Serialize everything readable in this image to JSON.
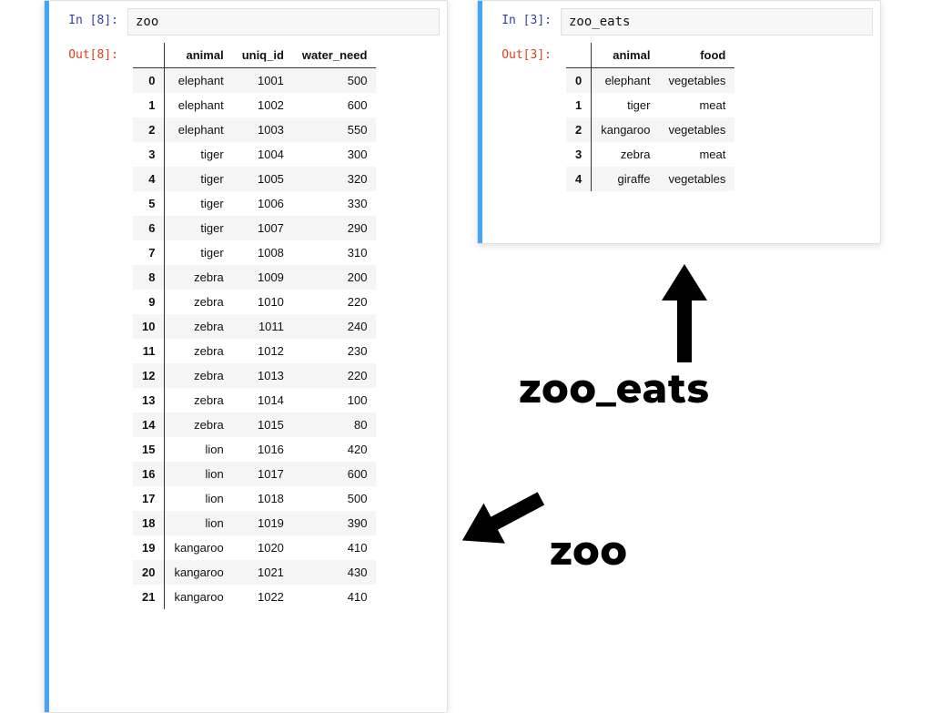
{
  "left_cell": {
    "in_prompt": "In [8]:",
    "out_prompt": "Out[8]:",
    "code": "zoo",
    "columns": [
      "animal",
      "uniq_id",
      "water_need"
    ],
    "rows": [
      {
        "idx": "0",
        "animal": "elephant",
        "uniq_id": "1001",
        "water_need": "500"
      },
      {
        "idx": "1",
        "animal": "elephant",
        "uniq_id": "1002",
        "water_need": "600"
      },
      {
        "idx": "2",
        "animal": "elephant",
        "uniq_id": "1003",
        "water_need": "550"
      },
      {
        "idx": "3",
        "animal": "tiger",
        "uniq_id": "1004",
        "water_need": "300"
      },
      {
        "idx": "4",
        "animal": "tiger",
        "uniq_id": "1005",
        "water_need": "320"
      },
      {
        "idx": "5",
        "animal": "tiger",
        "uniq_id": "1006",
        "water_need": "330"
      },
      {
        "idx": "6",
        "animal": "tiger",
        "uniq_id": "1007",
        "water_need": "290"
      },
      {
        "idx": "7",
        "animal": "tiger",
        "uniq_id": "1008",
        "water_need": "310"
      },
      {
        "idx": "8",
        "animal": "zebra",
        "uniq_id": "1009",
        "water_need": "200"
      },
      {
        "idx": "9",
        "animal": "zebra",
        "uniq_id": "1010",
        "water_need": "220"
      },
      {
        "idx": "10",
        "animal": "zebra",
        "uniq_id": "1011",
        "water_need": "240"
      },
      {
        "idx": "11",
        "animal": "zebra",
        "uniq_id": "1012",
        "water_need": "230"
      },
      {
        "idx": "12",
        "animal": "zebra",
        "uniq_id": "1013",
        "water_need": "220"
      },
      {
        "idx": "13",
        "animal": "zebra",
        "uniq_id": "1014",
        "water_need": "100"
      },
      {
        "idx": "14",
        "animal": "zebra",
        "uniq_id": "1015",
        "water_need": "80"
      },
      {
        "idx": "15",
        "animal": "lion",
        "uniq_id": "1016",
        "water_need": "420"
      },
      {
        "idx": "16",
        "animal": "lion",
        "uniq_id": "1017",
        "water_need": "600"
      },
      {
        "idx": "17",
        "animal": "lion",
        "uniq_id": "1018",
        "water_need": "500"
      },
      {
        "idx": "18",
        "animal": "lion",
        "uniq_id": "1019",
        "water_need": "390"
      },
      {
        "idx": "19",
        "animal": "kangaroo",
        "uniq_id": "1020",
        "water_need": "410"
      },
      {
        "idx": "20",
        "animal": "kangaroo",
        "uniq_id": "1021",
        "water_need": "430"
      },
      {
        "idx": "21",
        "animal": "kangaroo",
        "uniq_id": "1022",
        "water_need": "410"
      }
    ]
  },
  "right_cell": {
    "in_prompt": "In [3]:",
    "out_prompt": "Out[3]:",
    "code": "zoo_eats",
    "columns": [
      "animal",
      "food"
    ],
    "rows": [
      {
        "idx": "0",
        "animal": "elephant",
        "food": "vegetables"
      },
      {
        "idx": "1",
        "animal": "tiger",
        "food": "meat"
      },
      {
        "idx": "2",
        "animal": "kangaroo",
        "food": "vegetables"
      },
      {
        "idx": "3",
        "animal": "zebra",
        "food": "meat"
      },
      {
        "idx": "4",
        "animal": "giraffe",
        "food": "vegetables"
      }
    ]
  },
  "annotations": {
    "zoo_eats": "zoo_eats",
    "zoo": "zoo"
  }
}
